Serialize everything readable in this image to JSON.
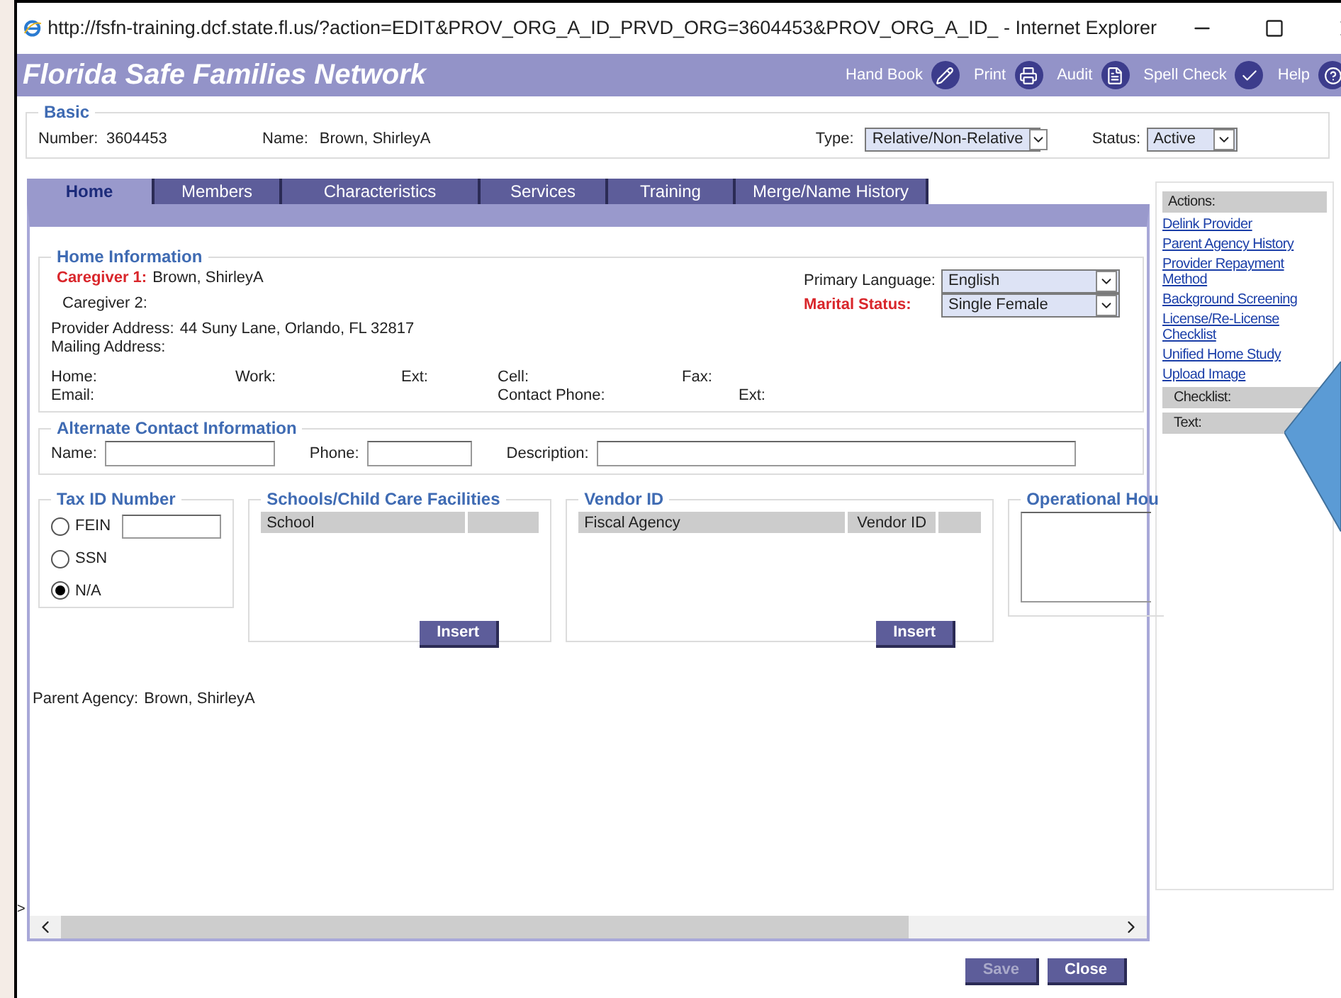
{
  "window": {
    "title": "http://fsfn-training.dcf.state.fl.us/?action=EDIT&PROV_ORG_A_ID_PRVD_ORG=3604453&PROV_ORG_A_ID_ - Internet Explorer"
  },
  "app_header": {
    "title": "Florida Safe Families Network",
    "tools": [
      {
        "label": "Hand Book",
        "kind": "pencil"
      },
      {
        "label": "Print",
        "kind": "printer"
      },
      {
        "label": "Audit",
        "kind": "document"
      },
      {
        "label": "Spell Check",
        "kind": "check"
      },
      {
        "label": "Help",
        "kind": "help"
      }
    ]
  },
  "basic": {
    "legend": "Basic",
    "number_label": "Number:",
    "number": "3604453",
    "name_label": "Name:",
    "name": "Brown, ShirleyA",
    "type_label": "Type:",
    "type_value": "Relative/Non-Relative",
    "status_label": "Status:",
    "status_value": "Active"
  },
  "tabs": [
    {
      "label": "Home",
      "selected": true
    },
    {
      "label": "Members",
      "selected": false
    },
    {
      "label": "Characteristics",
      "selected": false
    },
    {
      "label": "Services",
      "selected": false
    },
    {
      "label": "Training",
      "selected": false
    },
    {
      "label": "Merge/Name History",
      "selected": false
    }
  ],
  "home_information": {
    "legend": "Home Information",
    "caregiver1_label": "Caregiver 1:",
    "caregiver1": "Brown, ShirleyA",
    "caregiver2_label": "Caregiver 2:",
    "primary_language_label": "Primary Language:",
    "primary_language": "English",
    "marital_status_label": "Marital Status:",
    "marital_status": "Single Female",
    "provider_address_label": "Provider Address:",
    "provider_address": "44 Suny Lane, Orlando, FL 32817",
    "mailing_address_label": "Mailing Address:",
    "contact_row_1": [
      "Home:",
      "Work:",
      "Ext:",
      "Cell:",
      "Fax:"
    ],
    "contact_row_2": [
      "Email:",
      "Contact Phone:",
      "Ext:"
    ]
  },
  "alternate_contact": {
    "legend": "Alternate Contact Information",
    "fields": [
      {
        "label": "Name:"
      },
      {
        "label": "Phone:"
      },
      {
        "label": "Description:"
      }
    ]
  },
  "tax_id": {
    "legend": "Tax ID Number",
    "options": [
      {
        "label": "FEIN",
        "selected": false,
        "kind": "with_field"
      },
      {
        "label": "SSN",
        "selected": false,
        "kind": "plain"
      },
      {
        "label": "N/A",
        "selected": true,
        "kind": "plain"
      }
    ]
  },
  "schools": {
    "legend": "Schools/Child Care Facilities",
    "columns": [
      "School"
    ],
    "button": "Insert"
  },
  "vendor": {
    "legend": "Vendor ID",
    "columns": [
      "Fiscal Agency",
      "Vendor ID"
    ],
    "button": "Insert"
  },
  "operational_hours": {
    "legend": "Operational Hou"
  },
  "parent_agency": {
    "label": "Parent Agency:",
    "value": "Brown, ShirleyA"
  },
  "actions": {
    "header": "Actions:",
    "links": [
      "Delink Provider",
      "Parent Agency History",
      "Provider Repayment Method",
      "Background Screening",
      "License/Re-License Checklist",
      "Unified Home Study",
      "Upload Image"
    ],
    "sections": [
      "Checklist:",
      "Text:"
    ]
  },
  "stray_mark": ">",
  "footer_buttons": [
    {
      "label": "Save",
      "disabled": true
    },
    {
      "label": "Close",
      "disabled": false
    }
  ]
}
